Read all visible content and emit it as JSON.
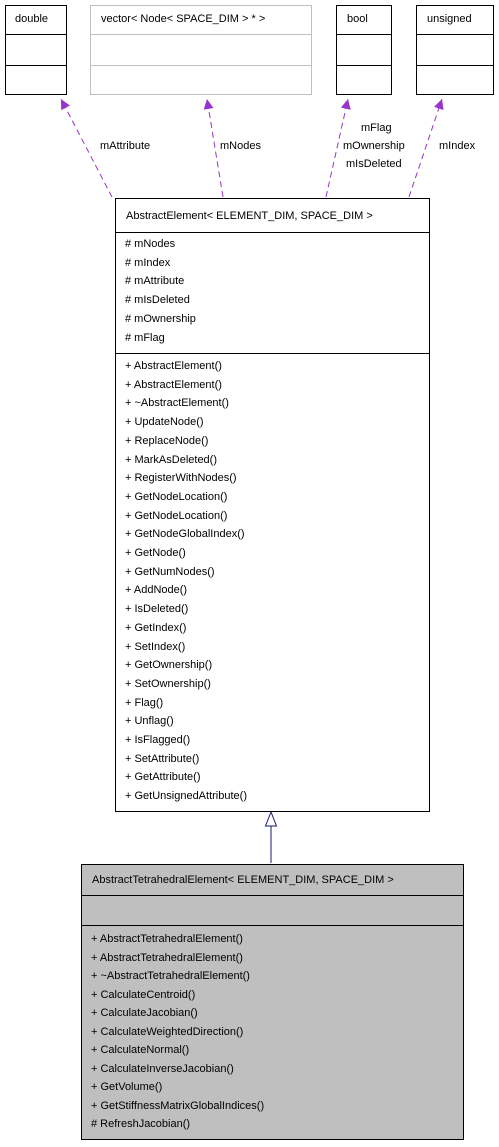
{
  "types": {
    "double": {
      "name": "double"
    },
    "vector": {
      "name": "vector< Node< SPACE_DIM > * >"
    },
    "bool": {
      "name": "bool"
    },
    "unsigned": {
      "name": "unsigned"
    }
  },
  "edge_labels": {
    "attribute": "mAttribute",
    "nodes": "mNodes",
    "bool": [
      "mFlag",
      "mOwnership",
      "mIsDeleted"
    ],
    "index": "mIndex"
  },
  "abstract_element": {
    "title": "AbstractElement< ELEMENT_DIM, SPACE_DIM >",
    "attributes": [
      "# mNodes",
      "# mIndex",
      "# mAttribute",
      "# mIsDeleted",
      "# mOwnership",
      "# mFlag"
    ],
    "methods": [
      "+ AbstractElement()",
      "+ AbstractElement()",
      "+ ~AbstractElement()",
      "+ UpdateNode()",
      "+ ReplaceNode()",
      "+ MarkAsDeleted()",
      "+ RegisterWithNodes()",
      "+ GetNodeLocation()",
      "+ GetNodeLocation()",
      "+ GetNodeGlobalIndex()",
      "+ GetNode()",
      "+ GetNumNodes()",
      "+ AddNode()",
      "+ IsDeleted()",
      "+ GetIndex()",
      "+ SetIndex()",
      "+ GetOwnership()",
      "+ SetOwnership()",
      "+ Flag()",
      "+ Unflag()",
      "+ IsFlagged()",
      "+ SetAttribute()",
      "+ GetAttribute()",
      "+ GetUnsignedAttribute()"
    ]
  },
  "tetra_element": {
    "title": "AbstractTetrahedralElement< ELEMENT_DIM, SPACE_DIM >",
    "methods": [
      "+ AbstractTetrahedralElement()",
      "+ AbstractTetrahedralElement()",
      "+ ~AbstractTetrahedralElement()",
      "+ CalculateCentroid()",
      "+ CalculateJacobian()",
      "+ CalculateWeightedDirection()",
      "+ CalculateNormal()",
      "+ CalculateInverseJacobian()",
      "+ GetVolume()",
      "+ GetStiffnessMatrixGlobalIndices()",
      "# RefreshJacobian()"
    ]
  },
  "colors": {
    "usage_arrow": "#9a32cd",
    "inheritance_arrow": "#191970",
    "derived_fill": "#bfbfbf",
    "external_border": "#bfbfbf"
  }
}
